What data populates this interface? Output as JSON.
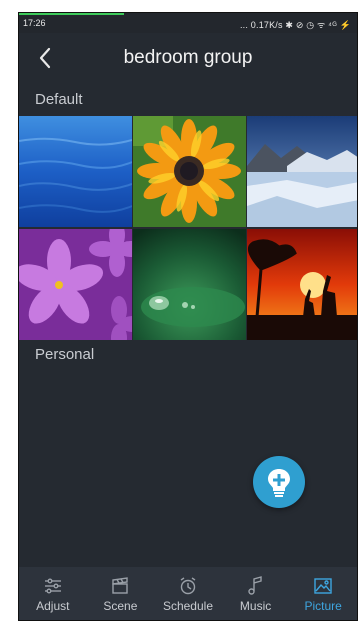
{
  "status_bar": {
    "time": "17:26",
    "indicators": "... 0.17K/s ✱ ⊘ ◷ ᯤ ⁴ᴳ ⚡"
  },
  "header": {
    "title": "bedroom group",
    "back_icon": "chevron-left-icon"
  },
  "sections": {
    "default_label": "Default",
    "personal_label": "Personal"
  },
  "pictures": [
    {
      "name": "ocean-water",
      "selected": false
    },
    {
      "name": "orange-flower",
      "selected": false
    },
    {
      "name": "frozen-lake-mountains",
      "selected": false
    },
    {
      "name": "purple-flowers",
      "selected": false
    },
    {
      "name": "water-droplet-leaf",
      "selected": false
    },
    {
      "name": "sunset-giraffes",
      "selected": false
    }
  ],
  "fab": {
    "icon": "add-bulb-icon"
  },
  "tabs": [
    {
      "label": "Adjust",
      "icon": "sliders-icon",
      "active": false
    },
    {
      "label": "Scene",
      "icon": "clapperboard-icon",
      "active": false
    },
    {
      "label": "Schedule",
      "icon": "alarm-clock-icon",
      "active": false
    },
    {
      "label": "Music",
      "icon": "music-note-icon",
      "active": false
    },
    {
      "label": "Picture",
      "icon": "picture-icon",
      "active": true
    }
  ],
  "colors": {
    "background": "#252a31",
    "accent": "#3ea6e0",
    "fab": "#2f9fd0",
    "tabbar": "#2d333c"
  }
}
